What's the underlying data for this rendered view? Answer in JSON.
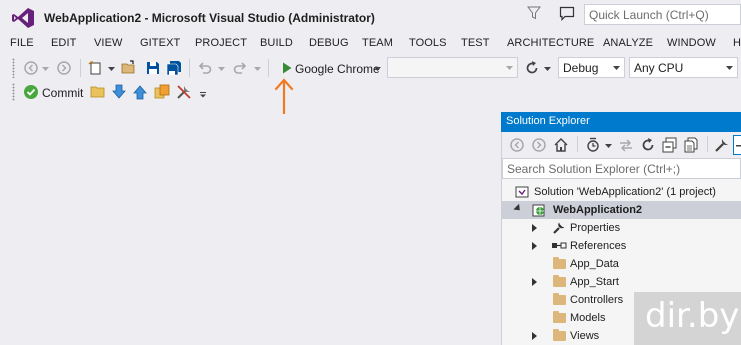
{
  "window": {
    "title": "WebApplication2 - Microsoft Visual Studio (Administrator)",
    "quick_launch_placeholder": "Quick Launch (Ctrl+Q)"
  },
  "menu": [
    "FILE",
    "EDIT",
    "VIEW",
    "GITEXT",
    "PROJECT",
    "BUILD",
    "DEBUG",
    "TEAM",
    "TOOLS",
    "TEST",
    "ARCHITECTURE",
    "ANALYZE",
    "WINDOW",
    "HELP"
  ],
  "toolbar": {
    "run_target": "Google Chrome",
    "configuration": "Debug",
    "platform": "Any CPU",
    "commit_label": "Commit"
  },
  "solution_explorer": {
    "title": "Solution Explorer",
    "search_placeholder": "Search Solution Explorer (Ctrl+;)",
    "solution_label": "Solution 'WebApplication2' (1 project)",
    "project_label": "WebApplication2",
    "items": [
      {
        "label": "Properties",
        "expandable": true,
        "icon": "wrench-icon"
      },
      {
        "label": "References",
        "expandable": true,
        "icon": "references-icon"
      },
      {
        "label": "App_Data",
        "expandable": false,
        "icon": "folder-icon"
      },
      {
        "label": "App_Start",
        "expandable": true,
        "icon": "folder-icon"
      },
      {
        "label": "Controllers",
        "expandable": false,
        "icon": "folder-icon"
      },
      {
        "label": "Models",
        "expandable": false,
        "icon": "folder-icon"
      },
      {
        "label": "Views",
        "expandable": true,
        "icon": "folder-icon"
      }
    ]
  },
  "watermark": "dir.by",
  "colors": {
    "accent": "#007acc",
    "vs_purple": "#68217a",
    "run_green": "#388a34",
    "annotation_arrow": "#f07a22"
  }
}
